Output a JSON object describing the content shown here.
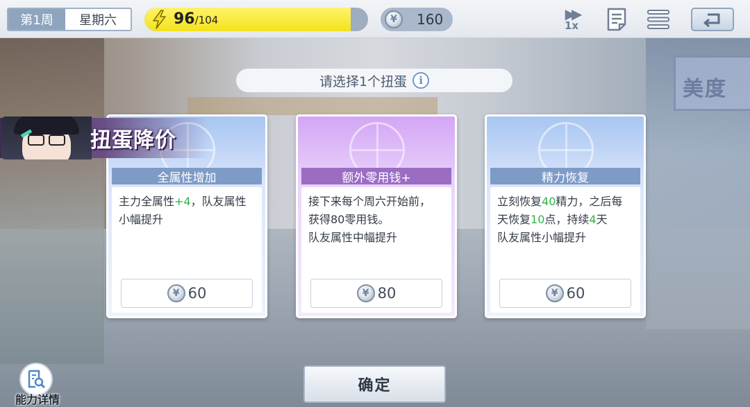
{
  "hud": {
    "week": "第1周",
    "day": "星期六",
    "energy": {
      "current": "96",
      "separator": "/",
      "max": "104",
      "fill_fraction": 0.923
    },
    "coins": "160",
    "speed_label": "1x"
  },
  "prompt": {
    "text": "请选择1个扭蛋"
  },
  "discount_banner": {
    "text": "扭蛋降价"
  },
  "cards": [
    {
      "title": "全属性增加",
      "desc": [
        [
          {
            "t": "主力全属性"
          },
          {
            "t": "+4",
            "hl": true
          },
          {
            "t": "，队友属性"
          }
        ],
        [
          {
            "t": "小幅提升"
          }
        ]
      ],
      "price": "60"
    },
    {
      "title": "额外零用钱+",
      "desc": [
        [
          {
            "t": "接下来每个周六开始前，"
          }
        ],
        [
          {
            "t": "获得80零用钱。"
          }
        ],
        [
          {
            "t": "队友属性中幅提升"
          }
        ]
      ],
      "price": "80"
    },
    {
      "title": "精力恢复",
      "desc": [
        [
          {
            "t": "立刻恢复"
          },
          {
            "t": "40",
            "hl": true
          },
          {
            "t": "精力，之后每"
          }
        ],
        [
          {
            "t": "天恢复"
          },
          {
            "t": "10",
            "hl": true
          },
          {
            "t": "点，持续"
          },
          {
            "t": "4",
            "hl": true
          },
          {
            "t": "天"
          }
        ],
        [
          {
            "t": "队友属性小幅提升"
          }
        ]
      ],
      "price": "60"
    }
  ],
  "confirm_label": "确定",
  "detail_label": "能力详情",
  "icons": {
    "energy": "lightning-icon",
    "coin": "coin-icon",
    "speed": "fast-forward-icon",
    "log": "log-icon",
    "menu": "menu-icon",
    "back": "back-icon",
    "info": "info-icon",
    "detail": "magnifier-document-icon"
  },
  "colors": {
    "energy_fill": "#f4e21d",
    "highlight_green": "#33b24a",
    "card_blue_header": "#7e9bc6",
    "card_purple_header": "#9a6dc3",
    "week_tag": "#8fa4bd"
  },
  "background_sign_text": "美度"
}
